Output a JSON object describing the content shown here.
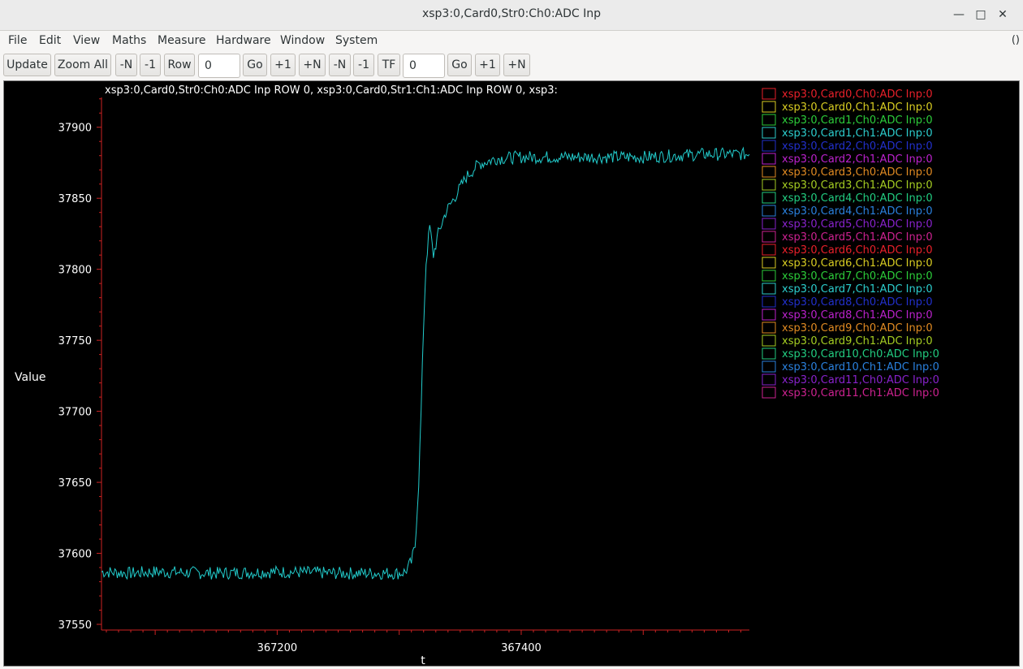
{
  "window": {
    "title": "xsp3:0,Card0,Str0:Ch0:ADC Inp",
    "controls": [
      "minimize-icon",
      "maximize-icon",
      "close-icon"
    ]
  },
  "menu": {
    "items": [
      "File",
      "Edit",
      "View",
      "Maths",
      "Measure",
      "Hardware",
      "Window",
      "System"
    ],
    "right": "()"
  },
  "toolbar": {
    "update": "Update",
    "zoom_all": "Zoom All",
    "minus_n_1": "-N",
    "minus_1_1": "-1",
    "row": "Row",
    "row_value": "0",
    "go_1": "Go",
    "plus_1_1": "+1",
    "plus_n_1": "+N",
    "minus_n_2": "-N",
    "minus_1_2": "-1",
    "tf": "TF",
    "tf_value": "0",
    "go_2": "Go",
    "plus_1_2": "+1",
    "plus_n_2": "+N"
  },
  "chart_data": {
    "type": "line",
    "title": "xsp3:0,Card0,Str0:Ch0:ADC Inp ROW 0, xsp3:0,Card0,Str1:Ch1:ADC Inp ROW 0, xsp3:",
    "xlabel": "t",
    "ylabel": "Value",
    "xlim": [
      367056,
      367587
    ],
    "ylim": [
      37546,
      37921
    ],
    "x_ticks": [
      367200,
      367400
    ],
    "y_ticks": [
      37550,
      37600,
      37650,
      37700,
      37750,
      37800,
      37850,
      37900
    ],
    "grid": false,
    "legend_position": "right",
    "background": "#000000",
    "axis_color": "#cc2222",
    "series": [
      {
        "name": "xsp3:0,Card1,Ch1:ADC Inp:0",
        "color": "#22cccc",
        "points": [
          [
            367056,
            37587
          ],
          [
            367080,
            37586
          ],
          [
            367100,
            37587
          ],
          [
            367150,
            37586
          ],
          [
            367200,
            37587
          ],
          [
            367250,
            37586
          ],
          [
            367300,
            37586
          ],
          [
            367305,
            37587
          ],
          [
            367310,
            37594
          ],
          [
            367313,
            37605
          ],
          [
            367316,
            37650
          ],
          [
            367318,
            37700
          ],
          [
            367320,
            37760
          ],
          [
            367322,
            37805
          ],
          [
            367325,
            37830
          ],
          [
            367328,
            37810
          ],
          [
            367332,
            37825
          ],
          [
            367338,
            37840
          ],
          [
            367345,
            37850
          ],
          [
            367355,
            37865
          ],
          [
            367365,
            37874
          ],
          [
            367380,
            37878
          ],
          [
            367400,
            37879
          ],
          [
            367450,
            37879
          ],
          [
            367500,
            37879
          ],
          [
            367550,
            37881
          ],
          [
            367587,
            37881
          ]
        ]
      }
    ],
    "legend_entries": [
      {
        "label": "xsp3:0,Card0,Ch0:ADC Inp:0",
        "color": "#e8202a"
      },
      {
        "label": "xsp3:0,Card0,Ch1:ADC Inp:0",
        "color": "#d8cc22"
      },
      {
        "label": "xsp3:0,Card1,Ch0:ADC Inp:0",
        "color": "#2ccc3a"
      },
      {
        "label": "xsp3:0,Card1,Ch1:ADC Inp:0",
        "color": "#2ccccc"
      },
      {
        "label": "xsp3:0,Card2,Ch0:ADC Inp:0",
        "color": "#2230cc"
      },
      {
        "label": "xsp3:0,Card2,Ch1:ADC Inp:0",
        "color": "#bb22cc"
      },
      {
        "label": "xsp3:0,Card3,Ch0:ADC Inp:0",
        "color": "#e08a22"
      },
      {
        "label": "xsp3:0,Card3,Ch1:ADC Inp:0",
        "color": "#a4cc22"
      },
      {
        "label": "xsp3:0,Card4,Ch0:ADC Inp:0",
        "color": "#22cc80"
      },
      {
        "label": "xsp3:0,Card4,Ch1:ADC Inp:0",
        "color": "#2a80dd"
      },
      {
        "label": "xsp3:0,Card5,Ch0:ADC Inp:0",
        "color": "#8822cc"
      },
      {
        "label": "xsp3:0,Card5,Ch1:ADC Inp:0",
        "color": "#cc2290"
      },
      {
        "label": "xsp3:0,Card6,Ch0:ADC Inp:0",
        "color": "#e8202a"
      },
      {
        "label": "xsp3:0,Card6,Ch1:ADC Inp:0",
        "color": "#d8cc22"
      },
      {
        "label": "xsp3:0,Card7,Ch0:ADC Inp:0",
        "color": "#2ccc3a"
      },
      {
        "label": "xsp3:0,Card7,Ch1:ADC Inp:0",
        "color": "#2ccccc"
      },
      {
        "label": "xsp3:0,Card8,Ch0:ADC Inp:0",
        "color": "#2230cc"
      },
      {
        "label": "xsp3:0,Card8,Ch1:ADC Inp:0",
        "color": "#bb22cc"
      },
      {
        "label": "xsp3:0,Card9,Ch0:ADC Inp:0",
        "color": "#e08a22"
      },
      {
        "label": "xsp3:0,Card9,Ch1:ADC Inp:0",
        "color": "#a4cc22"
      },
      {
        "label": "xsp3:0,Card10,Ch0:ADC Inp:0",
        "color": "#22cc80"
      },
      {
        "label": "xsp3:0,Card10,Ch1:ADC Inp:0",
        "color": "#2a80dd"
      },
      {
        "label": "xsp3:0,Card11,Ch0:ADC Inp:0",
        "color": "#8822cc"
      },
      {
        "label": "xsp3:0,Card11,Ch1:ADC Inp:0",
        "color": "#cc2290"
      }
    ]
  }
}
